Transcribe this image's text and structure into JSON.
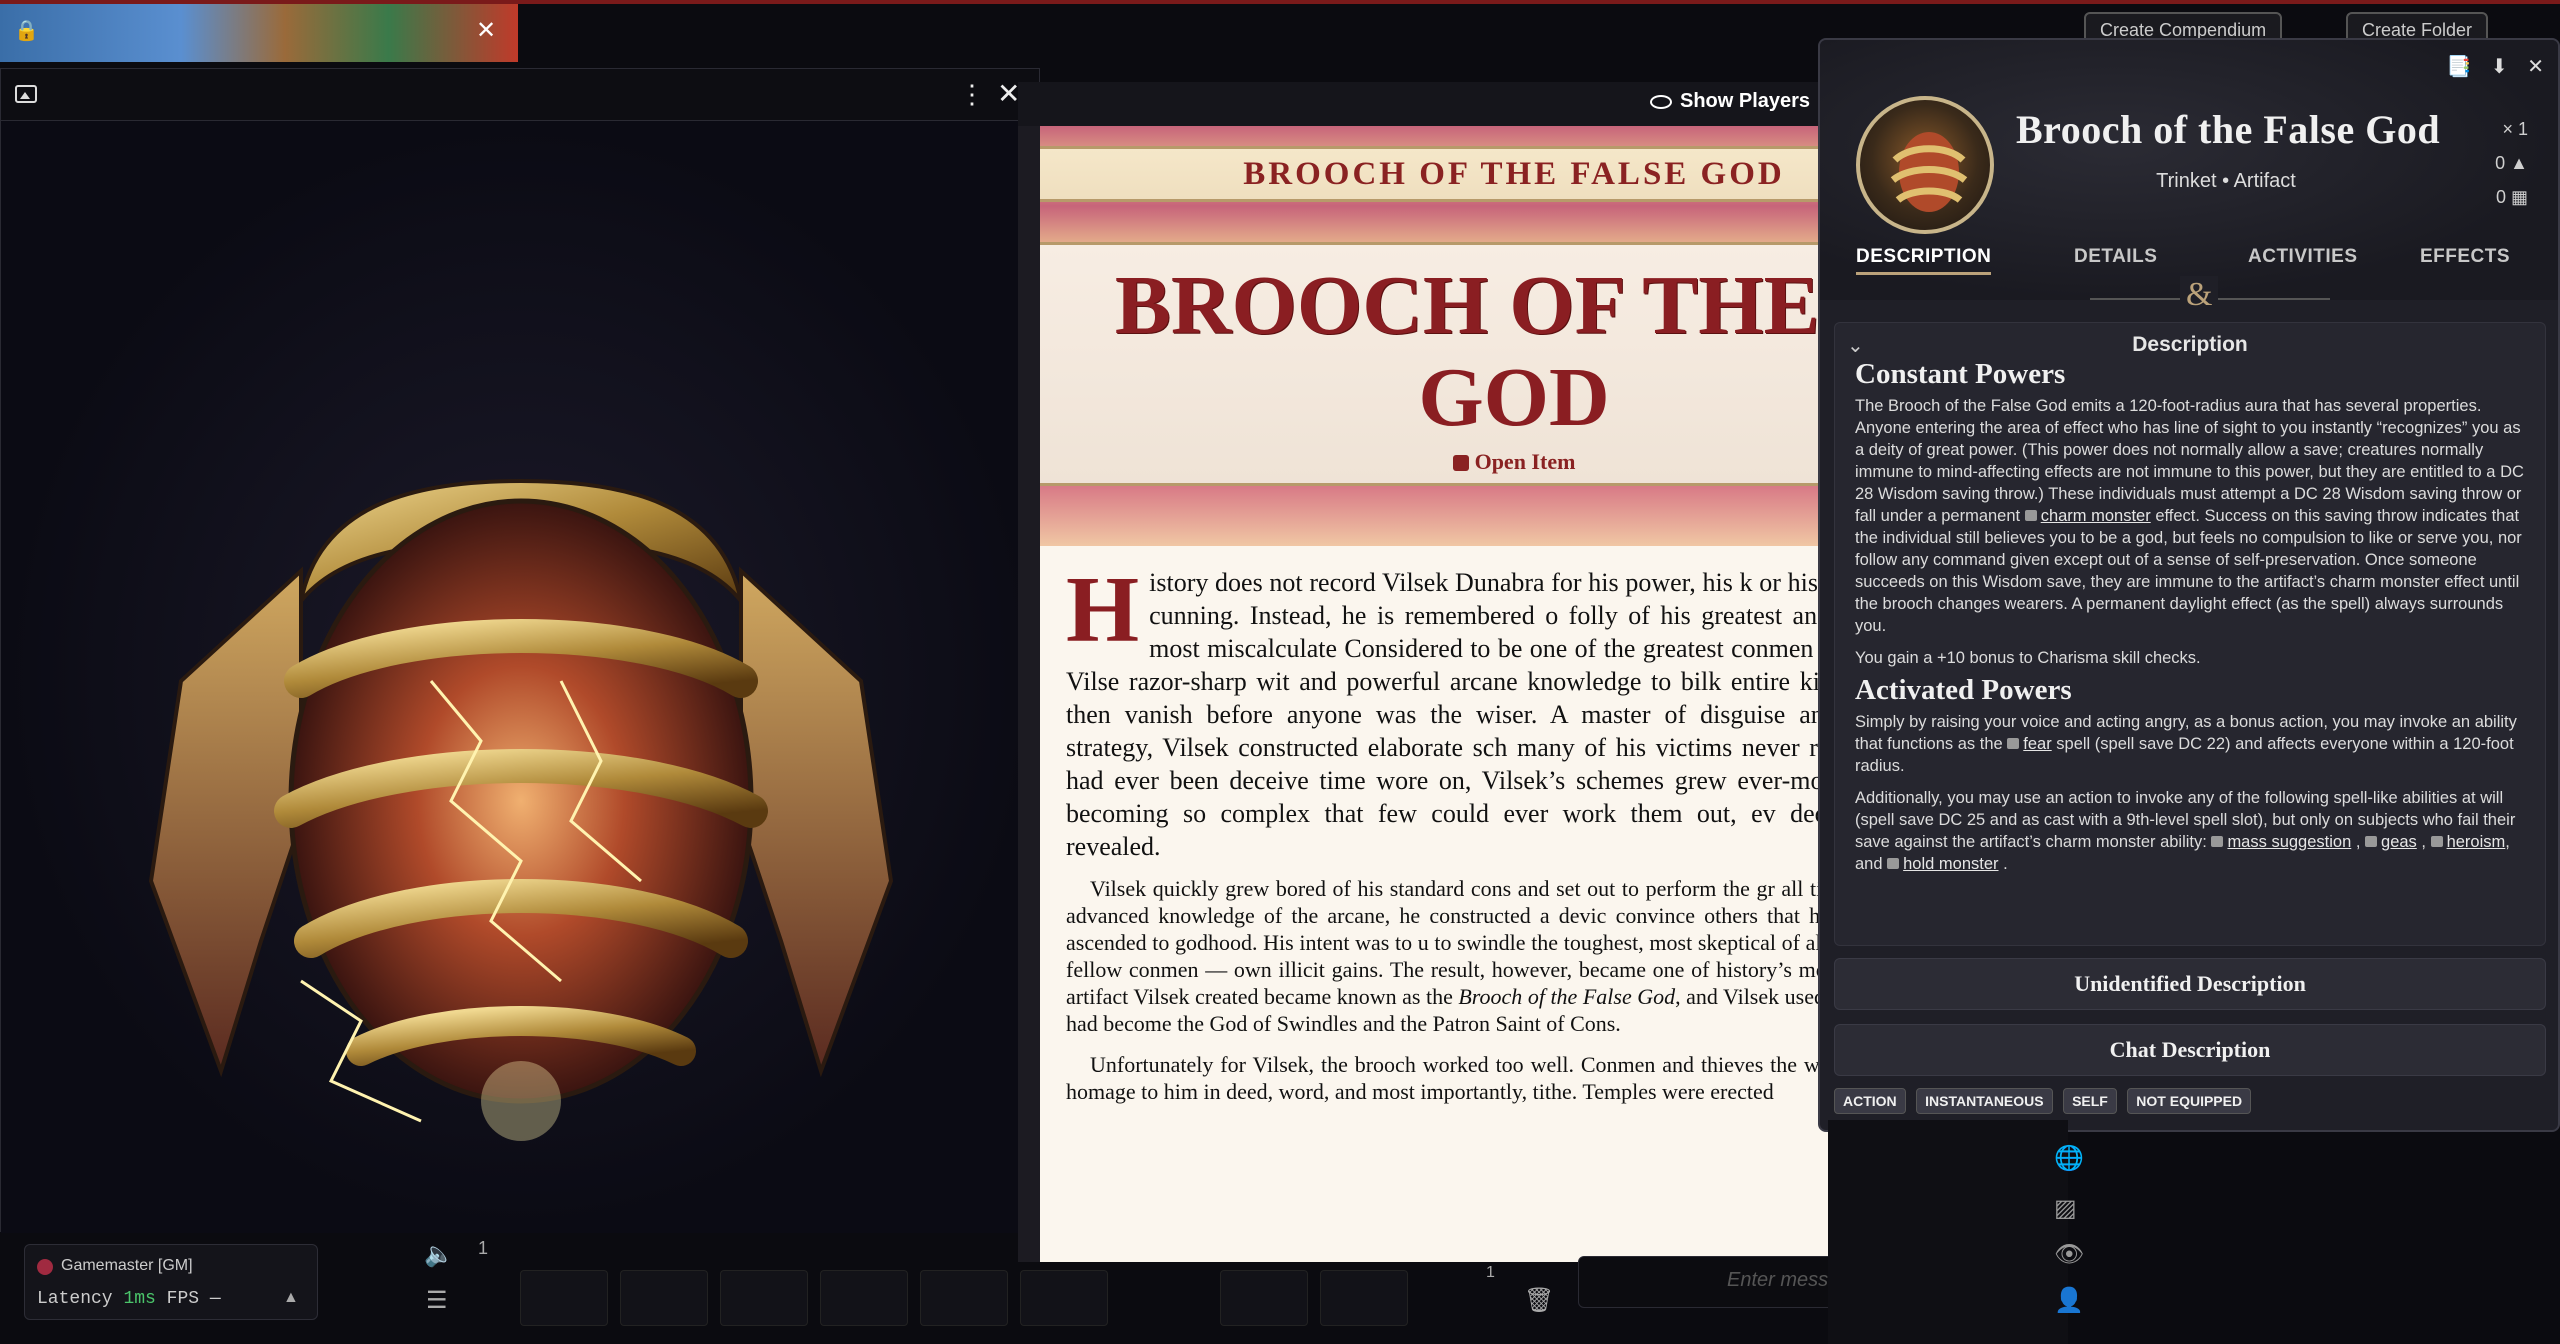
{
  "dock": {
    "create_compendium": "Create Compendium",
    "create_folder": "Create Folder"
  },
  "image_window": {
    "icon": "image-icon",
    "art_colors": {
      "accent": "#c9a04a",
      "glow": "#fff3b0"
    }
  },
  "journal": {
    "show_players": "Show Players",
    "banner": "BROOCH OF THE FALSE GOD",
    "title_line1": "BROOCH OF THE FALSE",
    "title_line2": "GOD",
    "open_item": "Open Item",
    "dropcap": "H",
    "lead": "istory does not record Vilsek Dunabra for his power, his k or his tremendous cunning. Instead, he is remembered o folly of his greatest and ultimately most miscalculate Considered to be one of the greatest conmen ever to live, Vilse razor-sharp wit and powerful arcane knowledge to bilk entire ki wealth and then vanish before anyone was the wiser. A master of disguise and elaborate strategy, Vilsek constructed elaborate sch many of his victims never realized they had ever been deceive time wore on, Vilsek’s schemes grew ever-more intricate, becoming so complex that few could ever work them out, ev deception was revealed.",
    "para1_a": "Vilsek quickly grew bored of his standard cons and set out to perform the gr all time. Using his advanced knowledge of the arcane, he constructed a devic convince others that he himself had ascended to godhood. His intent was to u to swindle the toughest, most skeptical of all marks — his fellow conmen — own illicit gains. The result, however, became one of history’s most astoun The artifact Vilsek created became known as the ",
    "para1_italic": "Brooch of the False God",
    "para1_b": ", and Vilsek used it to claim he had become the God of Swindles and the Patron Saint of Cons.",
    "para2": "Unfortunately for Vilsek, the brooch worked too well. Conmen and thieves the world over paid homage to him in deed, word, and most importantly, tithe. Temples were erected"
  },
  "sheet": {
    "name": "Brooch of the False God",
    "subtype": "Trinket • Artifact",
    "quantity": "× 1",
    "weight": "0",
    "price": "0",
    "tabs": [
      "DESCRIPTION",
      "DETAILS",
      "ACTIVITIES",
      "EFFECTS"
    ],
    "description_header": "Description",
    "constant_heading": "Constant Powers",
    "constant_text_a": "The Brooch of the False God emits a 120-foot-radius aura that has several properties. Anyone entering the area of effect who has line of sight to you instantly “recognizes” you as a deity of great power. (This power does not normally allow a save; creatures normally immune to mind-affecting effects are not immune to this power, but they are entitled to a DC 28 Wisdom saving throw.) These individuals must attempt a DC 28 Wisdom saving throw or fall under a permanent ",
    "link_charm": "charm monster",
    "constant_text_b": " effect. Success on this saving throw indicates that the individual still believes you to be a god, but feels no compulsion to like or serve you, nor follow any command given except out of a sense of self-preservation. Once someone succeeds on this Wisdom save, they are immune to the artifact’s charm monster effect until the brooch changes wearers. A permanent daylight effect (as the spell) always surrounds you.",
    "charisma_text": "You gain a +10 bonus to Charisma skill checks.",
    "activated_heading": "Activated Powers",
    "activated_text_a": "Simply by raising your voice and acting angry, as a bonus action, you may invoke an ability that functions as the ",
    "link_fear": "fear",
    "activated_text_b": " spell (spell save DC 22) and affects everyone within a 120-foot radius.",
    "additional_text": "Additionally, you may use an action to invoke any of the following spell-like abilities at will (spell save DC 25 and as cast with a 9th-level spell slot), but only on subjects who fail their save against the artifact’s charm monster ability: ",
    "link_mass": "mass suggestion",
    "link_geas": "geas",
    "link_heroism": "heroism",
    "and_text": ", and ",
    "link_hold": "hold monster",
    "unidentified": "Unidentified Description",
    "chat_description": "Chat Description",
    "tags": [
      "ACTION",
      "INSTANTANEOUS",
      "SELF",
      "NOT EQUIPPED"
    ]
  },
  "players": {
    "gm": "Gamemaster [GM]",
    "latency_label": "Latency",
    "latency_value": "1ms",
    "fps_label": "FPS",
    "fps_value": "—"
  },
  "hotbar": {
    "page": "1",
    "page2": "1"
  },
  "chat": {
    "placeholder": "Enter message"
  }
}
